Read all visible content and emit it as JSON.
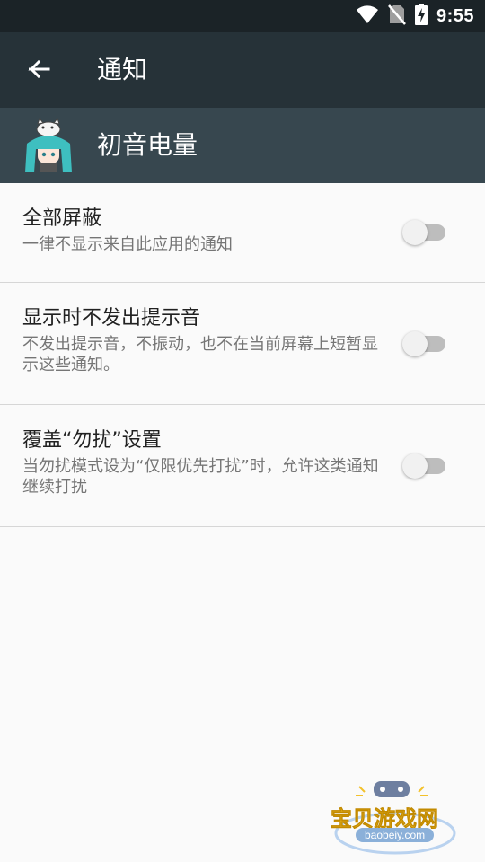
{
  "status": {
    "time": "9:55"
  },
  "toolbar": {
    "title": "通知"
  },
  "app": {
    "name": "初音电量"
  },
  "settings": [
    {
      "title": "全部屏蔽",
      "summary": "一律不显示来自此应用的通知",
      "enabled": false
    },
    {
      "title": "显示时不发出提示音",
      "summary": "不发出提示音，不振动，也不在当前屏幕上短暂显示这些通知。",
      "enabled": false
    },
    {
      "title": "覆盖“勿扰”设置",
      "summary": "当勿扰模式设为“仅限优先打扰”时，允许这类通知继续打扰",
      "enabled": false
    }
  ],
  "watermark": {
    "brand": "宝贝游戏网",
    "url": "baobeiy.com"
  },
  "colors": {
    "statusbar": "#1b2327",
    "toolbar": "#263238",
    "appbar": "#37474f",
    "background": "#fafafa",
    "switch_off_track": "#bdbdbd",
    "switch_off_thumb": "#f1f1f1"
  }
}
